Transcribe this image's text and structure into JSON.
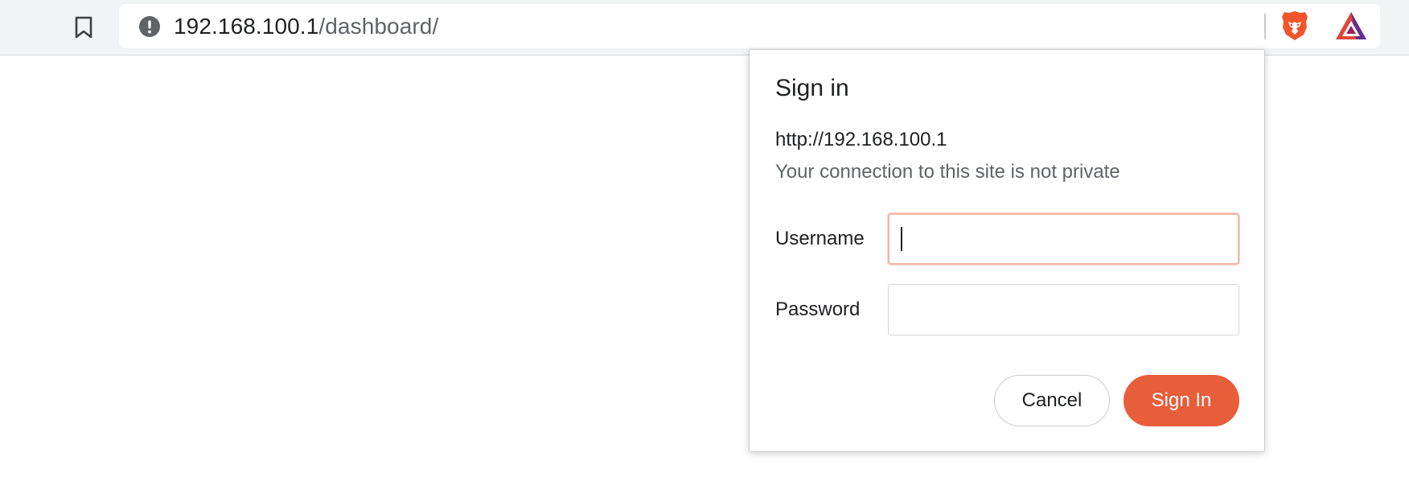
{
  "browser": {
    "url_host": "192.168.100.1",
    "url_path": "/dashboard/",
    "icons": {
      "bookmark": "bookmark-icon",
      "site_info": "info-icon",
      "brave_shields": "brave-shields-icon",
      "brave_rewards": "brave-rewards-icon"
    }
  },
  "dialog": {
    "title": "Sign in",
    "origin": "http://192.168.100.1",
    "warning": "Your connection to this site is not private",
    "username_label": "Username",
    "username_value": "",
    "password_label": "Password",
    "password_value": "",
    "cancel_label": "Cancel",
    "signin_label": "Sign In"
  },
  "colors": {
    "accent": "#e85d3a",
    "focus_border": "#f1b4a4",
    "toolbar_bg": "#f1f3f4"
  }
}
